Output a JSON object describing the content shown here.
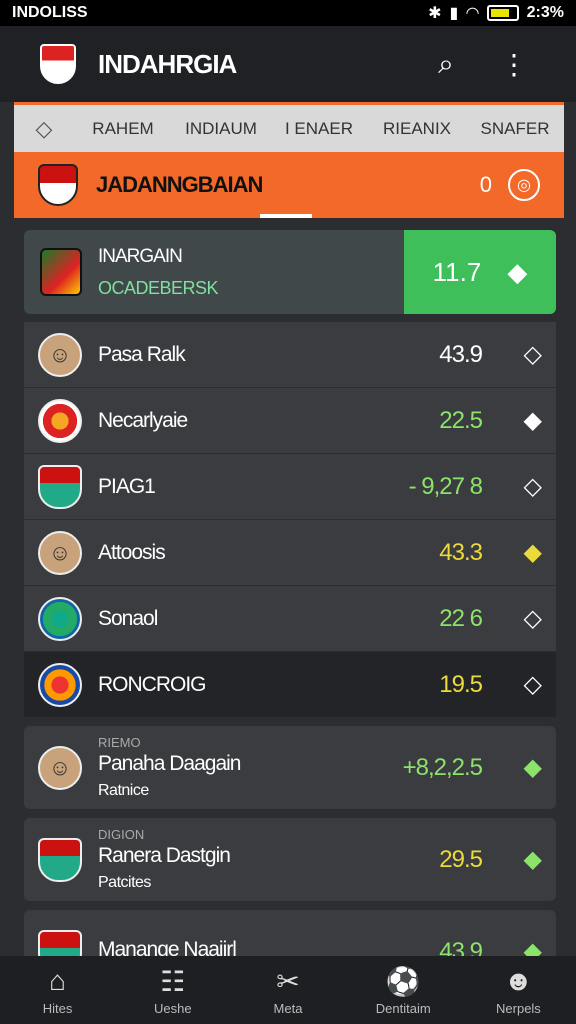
{
  "status": {
    "carrier": "INDOLISS",
    "battery": "2:3%",
    "icons": [
      "bluetooth-icon",
      "signal-icon",
      "wifi-icon"
    ]
  },
  "appbar": {
    "title": "INDAHRGIA",
    "search_icon": "search-icon",
    "menu_icon": "more-vert-icon"
  },
  "tabs": [
    "RAHEM",
    "INDIAUM",
    "I ENAER",
    "RIEANIX",
    "SNAFER"
  ],
  "league": {
    "title": "JADANNGBAIAN",
    "count": "0"
  },
  "featured": {
    "name": "INARGAIN",
    "sub": "OCADEBERSK",
    "score": "11.7"
  },
  "rows": [
    {
      "name": "Pasa Ralk",
      "score": "43.9",
      "color": "white"
    },
    {
      "name": "Necarlyaie",
      "score": "22.5",
      "color": "green"
    },
    {
      "name": "PIAG1",
      "score": "- 9,27 8",
      "color": "green"
    },
    {
      "name": "Attoosis",
      "score": "43.3",
      "color": "yellow"
    },
    {
      "name": "Sonaol",
      "score": "22 6",
      "color": "green"
    },
    {
      "name": "RONCROIG",
      "score": "19.5",
      "color": "yellow"
    }
  ],
  "detail_rows": [
    {
      "tag": "RIEMO",
      "title": "Panaha Daagain",
      "sub": "Ratnice",
      "score": "+8,2,2.5",
      "color": "green"
    },
    {
      "tag": "DIGION",
      "title": "Ranera Dastgin",
      "sub": "Patcites",
      "score": "29.5",
      "color": "yellow"
    },
    {
      "tag": "",
      "title": "Manange Naajirl",
      "sub": "",
      "score": "43.9",
      "color": "green"
    }
  ],
  "nav": [
    {
      "label": "Hites",
      "icon": "home-icon"
    },
    {
      "label": "Ueshe",
      "icon": "list-icon"
    },
    {
      "label": "Meta",
      "icon": "scissors-icon"
    },
    {
      "label": "Dentitaim",
      "icon": "ball-icon"
    },
    {
      "label": "Nerpels",
      "icon": "person-icon"
    }
  ]
}
